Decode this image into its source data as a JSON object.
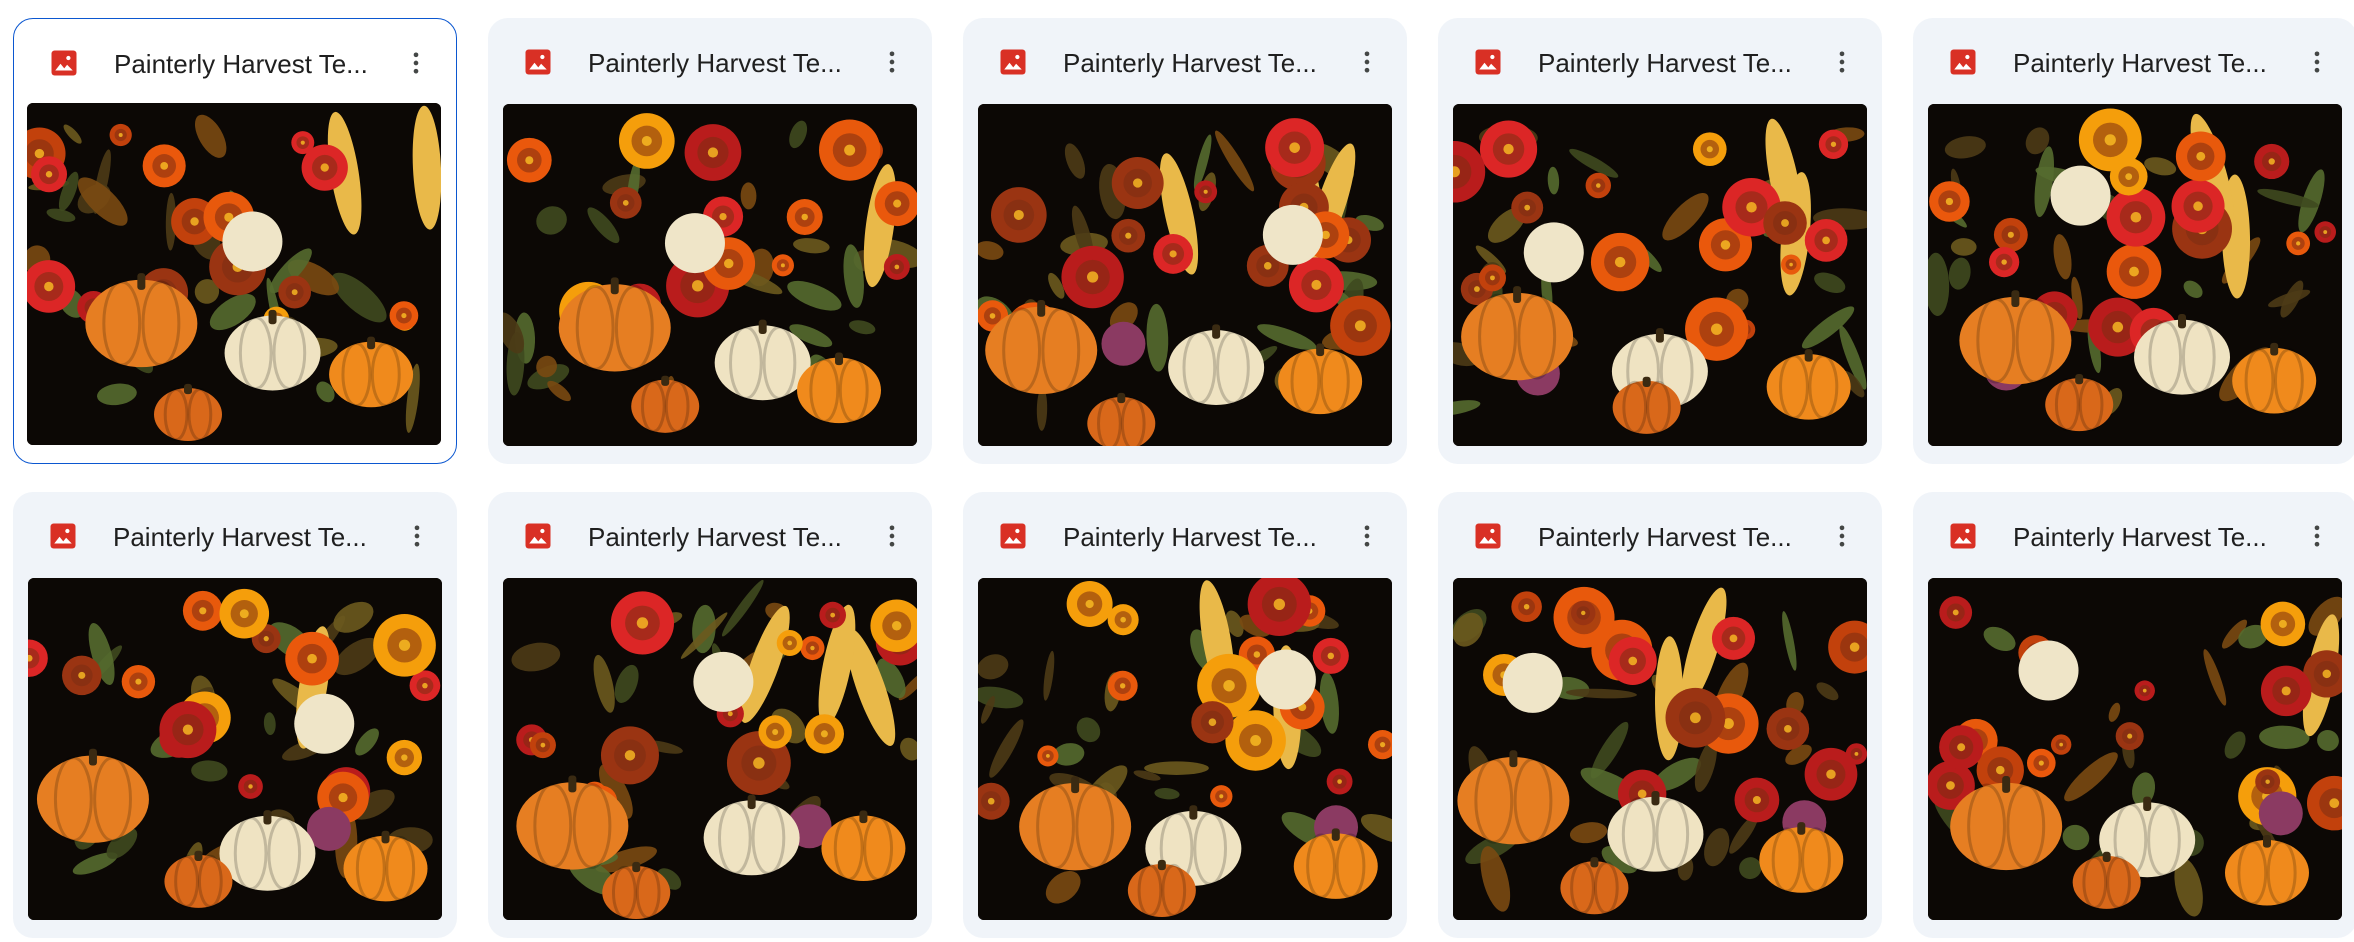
{
  "files": [
    {
      "title": "Painterly Harvest Te...",
      "icon": "image-file-icon",
      "selected": true
    },
    {
      "title": "Painterly Harvest Te...",
      "icon": "image-file-icon",
      "selected": false
    },
    {
      "title": "Painterly Harvest Te...",
      "icon": "image-file-icon",
      "selected": false
    },
    {
      "title": "Painterly Harvest Te...",
      "icon": "image-file-icon",
      "selected": false
    },
    {
      "title": "Painterly Harvest Te...",
      "icon": "image-file-icon",
      "selected": false
    },
    {
      "title": "Painterly Harvest Te...",
      "icon": "image-file-icon",
      "selected": false
    },
    {
      "title": "Painterly Harvest Te...",
      "icon": "image-file-icon",
      "selected": false
    },
    {
      "title": "Painterly Harvest Te...",
      "icon": "image-file-icon",
      "selected": false
    },
    {
      "title": "Painterly Harvest Te...",
      "icon": "image-file-icon",
      "selected": false
    },
    {
      "title": "Painterly Harvest Te...",
      "icon": "image-file-icon",
      "selected": false
    }
  ],
  "more_actions_icon": "more-vert-icon",
  "colors": {
    "card_bg": "#f0f4f9",
    "selected_border": "#0b57d0",
    "image_icon_red": "#d93025",
    "title_text": "#1f1f1f",
    "thumbnail_bg": "#0c0805"
  }
}
